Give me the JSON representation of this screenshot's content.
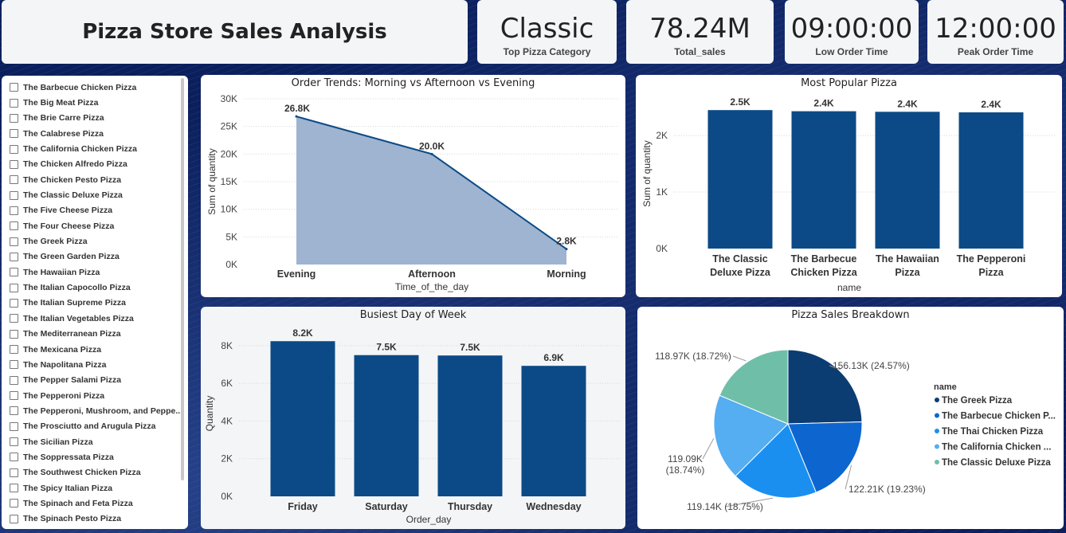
{
  "header": {
    "title": "Pizza Store Sales Analysis"
  },
  "kpis": [
    {
      "value": "Classic",
      "label": "Top Pizza Category"
    },
    {
      "value": "78.24M",
      "label": "Total_sales"
    },
    {
      "value": "09:00:00",
      "label": "Low Order Time"
    },
    {
      "value": "12:00:00",
      "label": "Peak Order Time"
    }
  ],
  "slicer": {
    "items": [
      "The Barbecue Chicken Pizza",
      "The Big Meat Pizza",
      "The Brie Carre Pizza",
      "The Calabrese Pizza",
      "The California Chicken Pizza",
      "The Chicken Alfredo Pizza",
      "The Chicken Pesto Pizza",
      "The Classic Deluxe Pizza",
      "The Five Cheese Pizza",
      "The Four Cheese Pizza",
      "The Greek Pizza",
      "The Green Garden Pizza",
      "The Hawaiian Pizza",
      "The Italian Capocollo Pizza",
      "The Italian Supreme Pizza",
      "The Italian Vegetables Pizza",
      "The Mediterranean Pizza",
      "The Mexicana Pizza",
      "The Napolitana Pizza",
      "The Pepper Salami Pizza",
      "The Pepperoni Pizza",
      "The Pepperoni, Mushroom, and Peppe...",
      "The Prosciutto and Arugula Pizza",
      "The Sicilian Pizza",
      "The Soppressata Pizza",
      "The Southwest Chicken Pizza",
      "The Spicy Italian Pizza",
      "The Spinach and Feta Pizza",
      "The Spinach Pesto Pizza"
    ]
  },
  "colors": {
    "bar": "#0b4a86",
    "area_fill": "#9eb4d0",
    "area_line": "#0b4a86",
    "pie": [
      "#0b3d73",
      "#0d66d0",
      "#1a8ff0",
      "#55adf2",
      "#6fbfa8"
    ]
  },
  "chart_data": [
    {
      "id": "order_trends",
      "type": "area",
      "title": "Order Trends: Morning vs Afternoon vs Evening",
      "xlabel": "Time_of_the_day",
      "ylabel": "Sum of quantity",
      "categories": [
        "Evening",
        "Afternoon",
        "Morning"
      ],
      "values": [
        26800,
        20000,
        2800
      ],
      "data_labels": [
        "26.8K",
        "20.0K",
        "2.8K"
      ],
      "ylim": [
        0,
        30000
      ],
      "yticks": [
        0,
        5000,
        10000,
        15000,
        20000,
        25000,
        30000
      ],
      "ytick_labels": [
        "0K",
        "5K",
        "10K",
        "15K",
        "20K",
        "25K",
        "30K"
      ],
      "grid": true
    },
    {
      "id": "most_popular",
      "type": "bar",
      "title": "Most Popular Pizza",
      "xlabel": "name",
      "ylabel": "Sum of quantity",
      "categories": [
        [
          "The Classic",
          "Deluxe Pizza"
        ],
        [
          "The Barbecue",
          "Chicken Pizza"
        ],
        [
          "The Hawaiian",
          "Pizza"
        ],
        [
          "The Pepperoni",
          "Pizza"
        ]
      ],
      "values": [
        2450,
        2430,
        2420,
        2410
      ],
      "data_labels": [
        "2.5K",
        "2.4K",
        "2.4K",
        "2.4K"
      ],
      "ylim": [
        0,
        2650
      ],
      "yticks": [
        0,
        1000,
        2000
      ],
      "ytick_labels": [
        "0K",
        "1K",
        "2K"
      ],
      "grid": true
    },
    {
      "id": "busiest_day",
      "type": "bar",
      "title": "Busiest Day of Week",
      "xlabel": "Order_day",
      "ylabel": "Quantity",
      "categories": [
        [
          "Friday"
        ],
        [
          "Saturday"
        ],
        [
          "Thursday"
        ],
        [
          "Wednesday"
        ]
      ],
      "values": [
        8240,
        7500,
        7480,
        6930
      ],
      "data_labels": [
        "8.2K",
        "7.5K",
        "7.5K",
        "6.9K"
      ],
      "ylim": [
        0,
        8800
      ],
      "yticks": [
        0,
        2000,
        4000,
        6000,
        8000
      ],
      "ytick_labels": [
        "0K",
        "2K",
        "4K",
        "6K",
        "8K"
      ],
      "grid": true
    },
    {
      "id": "sales_breakdown",
      "type": "pie",
      "title": "Pizza Sales Breakdown",
      "legend_title": "name",
      "legend_position": "right",
      "slices": [
        {
          "name": "The Greek Pizza",
          "value": 156.13,
          "label": "156.13K (24.57%)"
        },
        {
          "name": "The Barbecue Chicken P...",
          "value": 122.21,
          "label": "122.21K (19.23%)"
        },
        {
          "name": "The Thai Chicken Pizza",
          "value": 119.14,
          "label": "119.14K (18.75%)"
        },
        {
          "name": "The California Chicken ...",
          "value": 119.09,
          "label": "119.09K (18.74%)"
        },
        {
          "name": "The Classic Deluxe Pizza",
          "value": 118.97,
          "label": "118.97K (18.72%)"
        }
      ]
    }
  ]
}
